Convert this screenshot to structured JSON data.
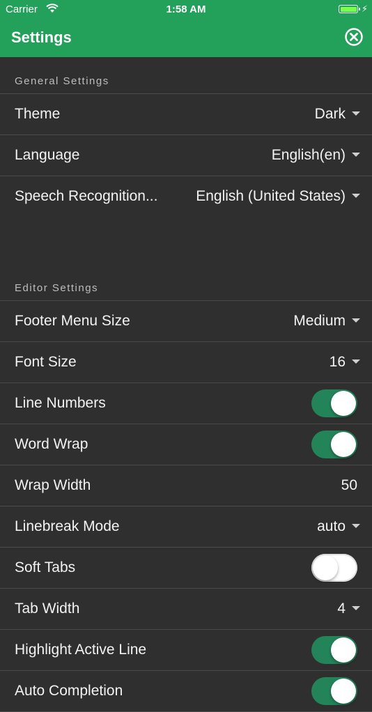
{
  "status_bar": {
    "carrier": "Carrier",
    "time": "1:58 AM",
    "battery_level_percent": 100,
    "charging": true
  },
  "nav": {
    "title": "Settings",
    "close_icon": "close-circle-icon"
  },
  "colors": {
    "accent": "#23a05a",
    "toggle_on": "#23845a",
    "background": "#2f2f2f"
  },
  "sections": {
    "general": {
      "header": "General Settings",
      "theme": {
        "label": "Theme",
        "value": "Dark"
      },
      "language": {
        "label": "Language",
        "value": "English(en)"
      },
      "speech": {
        "label": "Speech Recognition...",
        "value": "English (United States)"
      }
    },
    "editor": {
      "header": "Editor Settings",
      "footer_menu_size": {
        "label": "Footer Menu Size",
        "value": "Medium"
      },
      "font_size": {
        "label": "Font Size",
        "value": "16"
      },
      "line_numbers": {
        "label": "Line Numbers",
        "on": true
      },
      "word_wrap": {
        "label": "Word Wrap",
        "on": true
      },
      "wrap_width": {
        "label": "Wrap Width",
        "value": "50"
      },
      "linebreak_mode": {
        "label": "Linebreak Mode",
        "value": "auto"
      },
      "soft_tabs": {
        "label": "Soft Tabs",
        "on": false
      },
      "tab_width": {
        "label": "Tab Width",
        "value": "4"
      },
      "highlight_active_line": {
        "label": "Highlight Active Line",
        "on": true
      },
      "auto_completion": {
        "label": "Auto Completion",
        "on": true
      }
    }
  }
}
